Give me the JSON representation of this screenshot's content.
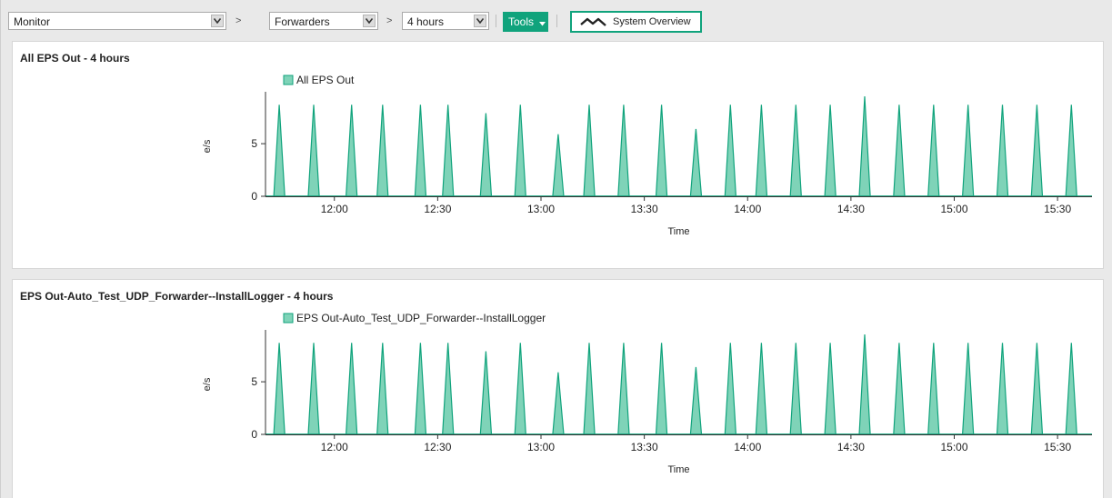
{
  "toolbar": {
    "category_select": "Monitor",
    "separator_1": ">",
    "entity_select": "Forwarders",
    "separator_2": ">",
    "range_select": "4 hours",
    "tools_label": "Tools",
    "system_overview_label": "System Overview"
  },
  "accent_color": "#10a37c",
  "panels": [
    {
      "title": "All EPS Out - 4 hours"
    },
    {
      "title": "EPS Out-Auto_Test_UDP_Forwarder--InstallLogger - 4 hours"
    }
  ],
  "chart_data": [
    {
      "type": "area",
      "title": "All EPS Out - 4 hours",
      "xlabel": "Time",
      "ylabel": "e/s",
      "x_ticks": [
        "12:00",
        "12:30",
        "13:00",
        "13:30",
        "14:00",
        "14:30",
        "15:00",
        "15:30"
      ],
      "y_ticks": [
        0,
        5
      ],
      "ylim": [
        0,
        9.5
      ],
      "x_range": [
        "11:40",
        "15:40"
      ],
      "series": [
        {
          "name": "All EPS Out",
          "color": "#10a37c",
          "fill": "#7fd3b8",
          "peaks": [
            {
              "time": "11:44",
              "value": 8.7
            },
            {
              "time": "11:54",
              "value": 8.7
            },
            {
              "time": "12:05",
              "value": 8.7
            },
            {
              "time": "12:14",
              "value": 8.7
            },
            {
              "time": "12:25",
              "value": 8.7
            },
            {
              "time": "12:33",
              "value": 8.7
            },
            {
              "time": "12:44",
              "value": 7.9
            },
            {
              "time": "12:54",
              "value": 8.7
            },
            {
              "time": "13:05",
              "value": 5.9
            },
            {
              "time": "13:14",
              "value": 8.7
            },
            {
              "time": "13:24",
              "value": 8.7
            },
            {
              "time": "13:35",
              "value": 8.7
            },
            {
              "time": "13:45",
              "value": 6.4
            },
            {
              "time": "13:55",
              "value": 8.7
            },
            {
              "time": "14:04",
              "value": 8.7
            },
            {
              "time": "14:14",
              "value": 8.7
            },
            {
              "time": "14:24",
              "value": 8.7
            },
            {
              "time": "14:34",
              "value": 9.5
            },
            {
              "time": "14:44",
              "value": 8.7
            },
            {
              "time": "14:54",
              "value": 8.7
            },
            {
              "time": "15:04",
              "value": 8.7
            },
            {
              "time": "15:14",
              "value": 8.7
            },
            {
              "time": "15:24",
              "value": 8.7
            },
            {
              "time": "15:34",
              "value": 8.7
            }
          ]
        }
      ]
    },
    {
      "type": "area",
      "title": "EPS Out-Auto_Test_UDP_Forwarder--InstallLogger - 4 hours",
      "xlabel": "Time",
      "ylabel": "e/s",
      "x_ticks": [
        "12:00",
        "12:30",
        "13:00",
        "13:30",
        "14:00",
        "14:30",
        "15:00",
        "15:30"
      ],
      "y_ticks": [
        0,
        5
      ],
      "ylim": [
        0,
        9.5
      ],
      "x_range": [
        "11:40",
        "15:40"
      ],
      "series": [
        {
          "name": "EPS Out-Auto_Test_UDP_Forwarder--InstallLogger",
          "color": "#10a37c",
          "fill": "#7fd3b8",
          "peaks": [
            {
              "time": "11:44",
              "value": 8.7
            },
            {
              "time": "11:54",
              "value": 8.7
            },
            {
              "time": "12:05",
              "value": 8.7
            },
            {
              "time": "12:14",
              "value": 8.7
            },
            {
              "time": "12:25",
              "value": 8.7
            },
            {
              "time": "12:33",
              "value": 8.7
            },
            {
              "time": "12:44",
              "value": 7.9
            },
            {
              "time": "12:54",
              "value": 8.7
            },
            {
              "time": "13:05",
              "value": 5.9
            },
            {
              "time": "13:14",
              "value": 8.7
            },
            {
              "time": "13:24",
              "value": 8.7
            },
            {
              "time": "13:35",
              "value": 8.7
            },
            {
              "time": "13:45",
              "value": 6.4
            },
            {
              "time": "13:55",
              "value": 8.7
            },
            {
              "time": "14:04",
              "value": 8.7
            },
            {
              "time": "14:14",
              "value": 8.7
            },
            {
              "time": "14:24",
              "value": 8.7
            },
            {
              "time": "14:34",
              "value": 9.5
            },
            {
              "time": "14:44",
              "value": 8.7
            },
            {
              "time": "14:54",
              "value": 8.7
            },
            {
              "time": "15:04",
              "value": 8.7
            },
            {
              "time": "15:14",
              "value": 8.7
            },
            {
              "time": "15:24",
              "value": 8.7
            },
            {
              "time": "15:34",
              "value": 8.7
            }
          ]
        }
      ]
    }
  ]
}
